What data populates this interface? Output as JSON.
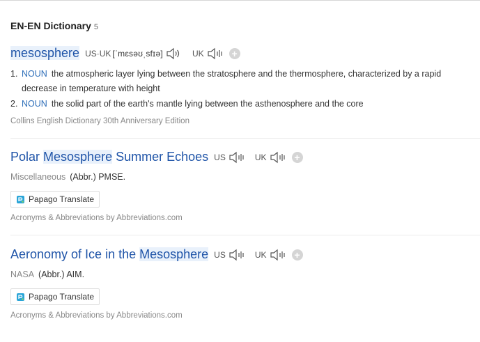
{
  "section": {
    "title": "EN-EN Dictionary",
    "count": "5"
  },
  "entries": [
    {
      "headword": "mesosphere",
      "pron_us_uk": "US·UK",
      "ipa": "[ˈmɛsəʊˌsfɪə]",
      "uk_label": "UK",
      "senses": [
        {
          "num": "1.",
          "pos": "NOUN",
          "text": "the atmospheric layer lying between the stratosphere and the thermosphere, characterized by a rapid decrease in temperature with height"
        },
        {
          "num": "2.",
          "pos": "NOUN",
          "text": "the solid part of the earth's mantle lying between the asthenosphere and the core"
        }
      ],
      "source": "Collins English Dictionary 30th Anniversary Edition"
    },
    {
      "headword_pre": "Polar ",
      "headword_hl": "Mesosphere",
      "headword_post": " Summer Echoes",
      "us_label": "US",
      "uk_label": "UK",
      "category": "Miscellaneous",
      "abbr": "(Abbr.) PMSE.",
      "papago": "Papago Translate",
      "source": "Acronyms & Abbreviations by Abbreviations.com"
    },
    {
      "headword_pre": "Aeronomy of Ice in the ",
      "headword_hl": "Mesosphere",
      "headword_post": "",
      "us_label": "US",
      "uk_label": "UK",
      "category": "NASA",
      "abbr": "(Abbr.) AIM.",
      "papago": "Papago Translate",
      "source": "Acronyms & Abbreviations by Abbreviations.com"
    }
  ],
  "icons": {
    "speaker": "speaker-icon",
    "add": "add-icon",
    "papago": "papago-icon"
  },
  "colors": {
    "link": "#1f54a8",
    "pos": "#2f6fb9",
    "highlight": "#e9f1fb",
    "papago": "#2aa5d8"
  }
}
